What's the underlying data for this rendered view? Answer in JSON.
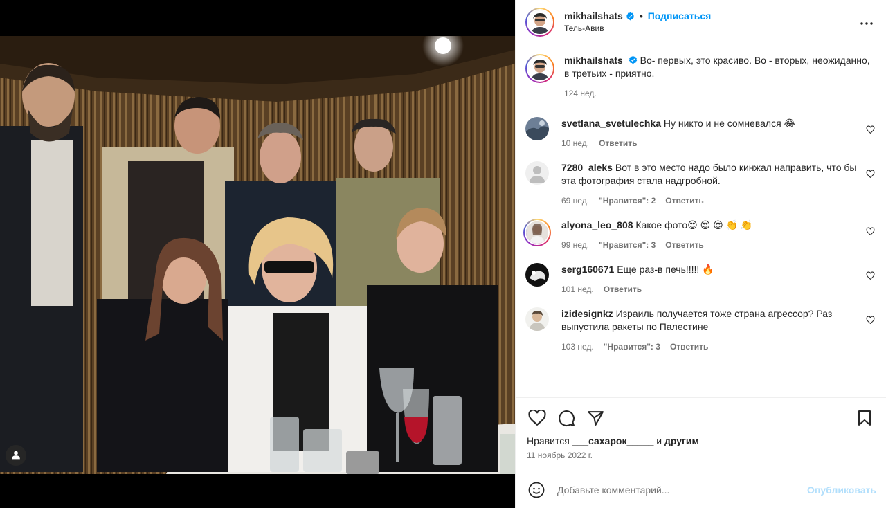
{
  "post": {
    "author": "mikhailshats",
    "follow_label": "Подписаться",
    "dot": "•",
    "location": "Тель-Авив"
  },
  "caption": {
    "author": "mikhailshats",
    "text": "Во- первых, это красиво. Во - вторых, неожиданно, в третьих - приятно.",
    "time": "124 нед."
  },
  "comments": [
    {
      "user": "svetlana_svetulechka",
      "text": "Ну никто и не сомневался 😂",
      "time": "10 нед.",
      "likes": "",
      "reply": "Ответить"
    },
    {
      "user": "7280_aleks",
      "text": "Вот в это место надо было кинжал направить, что бы эта фотография стала надгробной.",
      "time": "69 нед.",
      "likes": "\"Нравится\": 2",
      "reply": "Ответить"
    },
    {
      "user": "alyona_leo_808",
      "text": "Какое фото😍 😍 😍 👏 👏",
      "time": "99 нед.",
      "likes": "\"Нравится\": 3",
      "reply": "Ответить"
    },
    {
      "user": "serg160671",
      "text": "Еще раз-в печь!!!!! 🔥",
      "time": "101 нед.",
      "likes": "",
      "reply": "Ответить"
    },
    {
      "user": "izidesignkz",
      "text": "Израиль получается тоже страна агрессор? Раз выпустила ракеты по Палестине",
      "time": "103 нед.",
      "likes": "\"Нравится\": 3",
      "reply": "Ответить"
    }
  ],
  "likes_line": {
    "prefix": "Нравится",
    "user": "___сахарок_____",
    "middle": "и",
    "suffix": "другим"
  },
  "date": "11 ноябрь 2022 г.",
  "add_comment": {
    "placeholder": "Добавьте комментарий...",
    "publish": "Опубликовать"
  },
  "icons": {
    "more": "more-horizontal-icon",
    "like": "heart-icon",
    "comment": "comment-icon",
    "share": "paper-plane-icon",
    "save": "bookmark-icon",
    "emoji": "smiley-icon",
    "tags": "user-tag-icon",
    "verified": "verified-badge-icon"
  },
  "colors": {
    "accent": "#0095f6",
    "verified": "#0095f6",
    "publish_disabled": "#b2dffc",
    "muted": "#737373"
  }
}
